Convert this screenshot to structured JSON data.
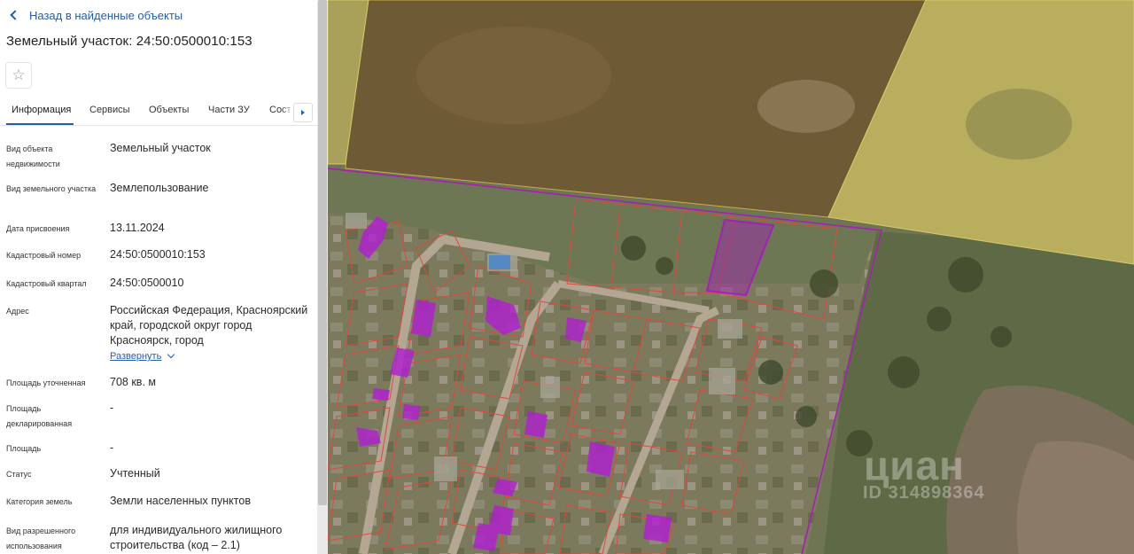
{
  "panel": {
    "back_label": "Назад в найденные объекты",
    "title": "Земельный участок: 24:50:0500010:153",
    "favorite_icon": "star-icon",
    "tabs": [
      "Информация",
      "Сервисы",
      "Объекты",
      "Части ЗУ",
      "Сост"
    ],
    "active_tab": "Информация",
    "tab_next_icon": "triangle-right-icon",
    "rows": [
      {
        "label": "Вид объекта недвижимости",
        "value": "Земельный участок"
      },
      {
        "label": "Вид земельного участка",
        "value": "Землепользование"
      },
      {
        "label": "Дата присвоения",
        "value": "13.11.2024"
      },
      {
        "label": "Кадастровый номер",
        "value": "24:50:0500010:153"
      },
      {
        "label": "Кадастровый квартал",
        "value": "24:50:0500010"
      },
      {
        "label": "Адрес",
        "value": "Российская Федерация, Красноярский край, городской округ город Красноярск, город"
      },
      {
        "label": "Площадь уточненная",
        "value": "708 кв. м"
      },
      {
        "label": "Площадь декларированная",
        "value": "-"
      },
      {
        "label": "Площадь",
        "value": "-"
      },
      {
        "label": "Статус",
        "value": "Учтенный"
      },
      {
        "label": "Категория земель",
        "value": "Земли населенных пунктов"
      },
      {
        "label": "Вид разрешенного использования",
        "value": "для индивидуального жилищного строительства (код – 2.1)"
      }
    ],
    "expand_label": "Развернуть"
  },
  "map": {
    "watermark": "циан",
    "watermark_id": "ID 314898364",
    "colors": {
      "field_brown": "#6e5a34",
      "field_yellow": "#b9ad5e",
      "selected_parcel": "#a51fb8",
      "parcel_outline": "#e0473e",
      "building_magenta": "#b020d0"
    }
  }
}
